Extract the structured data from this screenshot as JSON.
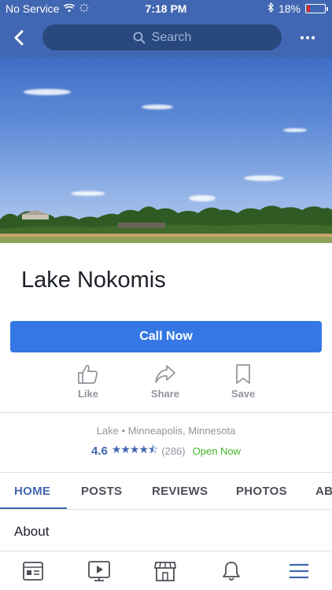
{
  "status_bar": {
    "carrier": "No Service",
    "time": "7:18 PM",
    "battery_percent": "18%",
    "battery_level": 0.18,
    "battery_color": "#e0262b"
  },
  "nav": {
    "back_icon": "chevron-left-icon",
    "search_placeholder": "Search",
    "more_icon": "more-dots-icon"
  },
  "page": {
    "title": "Lake Nokomis",
    "call_button_label": "Call Now",
    "category": "Lake",
    "location": "Minneapolis, Minnesota",
    "rating": "4.6",
    "rating_stars": 4.6,
    "review_count": "(286)",
    "open_status": "Open Now"
  },
  "actions": [
    {
      "label": "Like",
      "icon": "thumbs-up-icon"
    },
    {
      "label": "Share",
      "icon": "share-arrow-icon"
    },
    {
      "label": "Save",
      "icon": "bookmark-icon"
    }
  ],
  "tabs": [
    {
      "label": "HOME",
      "active": true
    },
    {
      "label": "POSTS",
      "active": false
    },
    {
      "label": "REVIEWS",
      "active": false
    },
    {
      "label": "PHOTOS",
      "active": false
    },
    {
      "label": "AB",
      "active": false
    }
  ],
  "section": {
    "title": "About"
  },
  "bottom_nav": [
    {
      "icon": "news-feed-icon"
    },
    {
      "icon": "video-icon"
    },
    {
      "icon": "marketplace-icon"
    },
    {
      "icon": "bell-icon"
    },
    {
      "icon": "menu-icon",
      "active": true
    }
  ],
  "colors": {
    "brand": "#4267b2",
    "search_bg": "#29487d",
    "call_button": "#3578e5",
    "open_green": "#42b72a"
  }
}
